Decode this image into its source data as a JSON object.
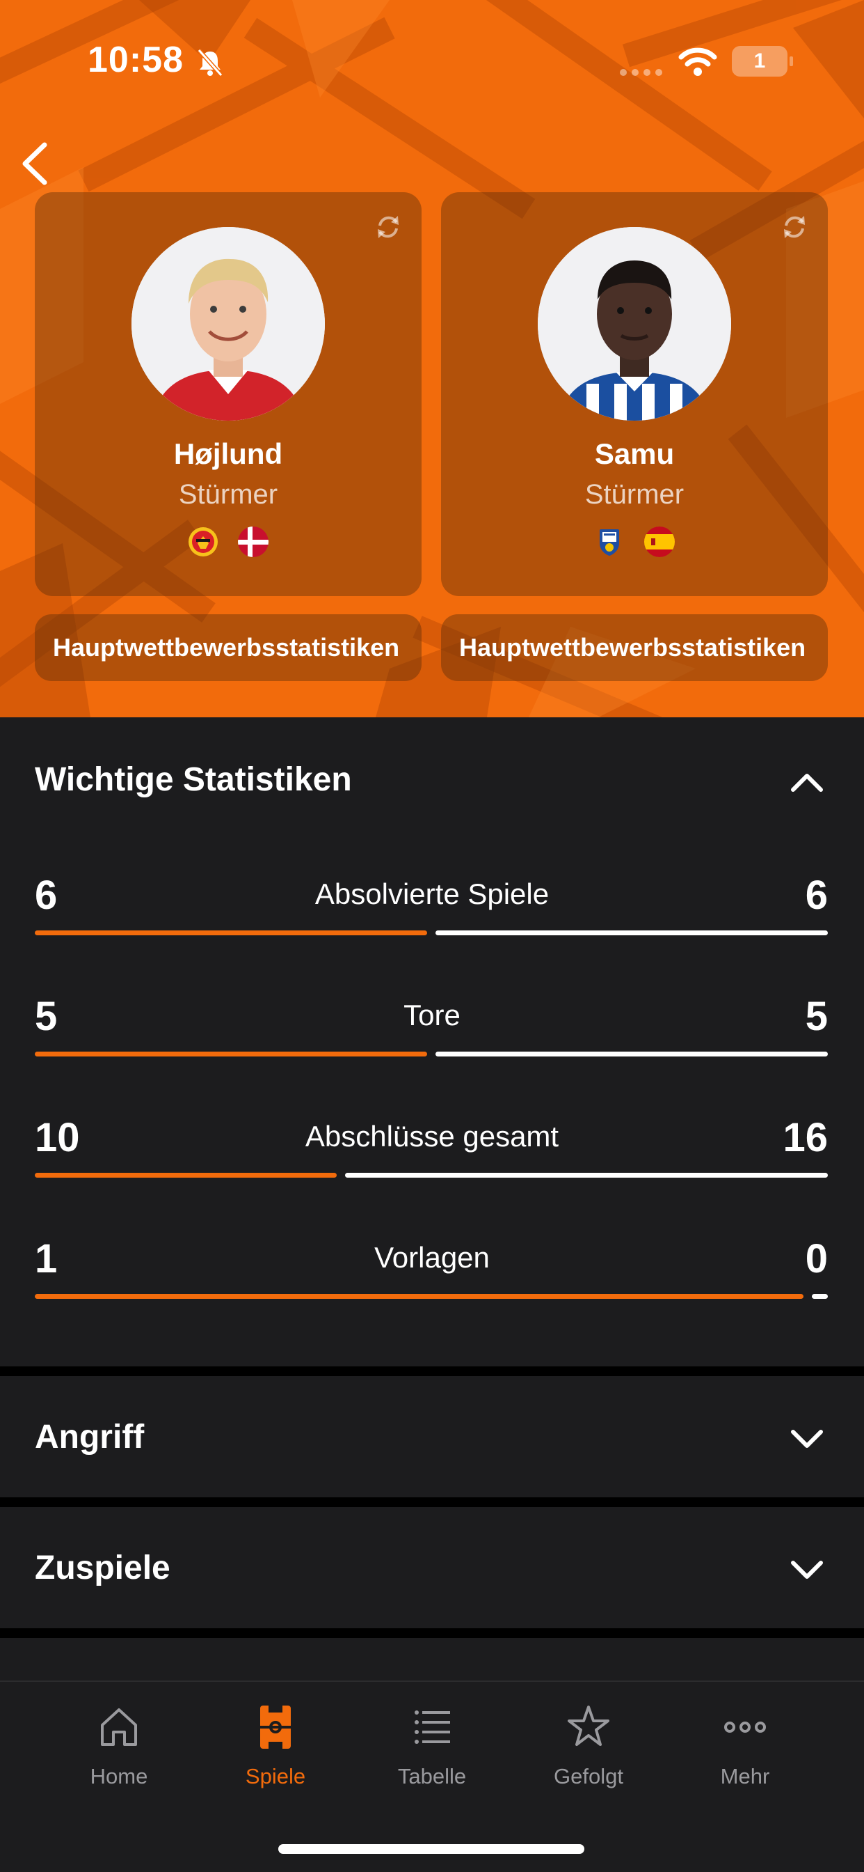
{
  "status": {
    "time": "10:58",
    "battery": "1"
  },
  "players": [
    {
      "name": "Højlund",
      "position": "Stürmer",
      "badges": [
        "manchester-united-crest",
        "denmark-flag"
      ],
      "competition_button": "Hauptwettbewerbsstatistiken"
    },
    {
      "name": "Samu",
      "position": "Stürmer",
      "badges": [
        "fc-porto-crest",
        "spain-flag"
      ],
      "competition_button": "Hauptwettbewerbsstatistiken"
    }
  ],
  "sections": {
    "key_stats": "Wichtige Statistiken",
    "attack": "Angriff",
    "passing": "Zuspiele"
  },
  "stats": [
    {
      "label": "Absolvierte Spiele",
      "left": "6",
      "right": "6",
      "left_share": 0.5
    },
    {
      "label": "Tore",
      "left": "5",
      "right": "5",
      "left_share": 0.5
    },
    {
      "label": "Abschlüsse gesamt",
      "left": "10",
      "right": "16",
      "left_share": 0.385
    },
    {
      "label": "Vorlagen",
      "left": "1",
      "right": "0",
      "left_share": 0.98
    }
  ],
  "colors": {
    "accent": "#f26b0c",
    "background": "#1c1c1e",
    "bar_right": "#ffffff"
  },
  "tabbar": {
    "items": [
      {
        "label": "Home",
        "icon": "house-icon",
        "active": false
      },
      {
        "label": "Spiele",
        "icon": "pitch-icon",
        "active": true
      },
      {
        "label": "Tabelle",
        "icon": "list-icon",
        "active": false
      },
      {
        "label": "Gefolgt",
        "icon": "star-icon",
        "active": false
      },
      {
        "label": "Mehr",
        "icon": "more-icon",
        "active": false
      }
    ]
  }
}
